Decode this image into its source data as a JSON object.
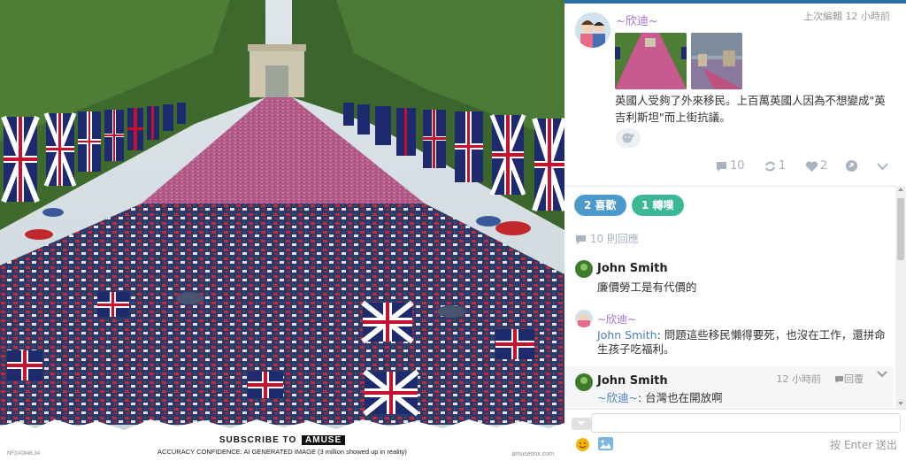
{
  "photo": {
    "subscribe_prefix": "SUBSCRIBE TO",
    "subscribe_brand": "AMUSE",
    "accuracy_text": "ACCURACY CONFIDENCE: AI GENERATED IMAGE (3 million showed up in reality)",
    "image_id": "NF3A0846.34",
    "site": "amuseonx.com"
  },
  "post": {
    "author": "~欣迪~",
    "last_edit": "上次編輯  12 小時前",
    "text": "英國人受夠了外來移民。上百萬英國人因為不想變成\"英吉利斯坦\"而上街抗議。",
    "stats": {
      "replies": "10",
      "reblogs": "1",
      "likes": "2"
    },
    "likes_pill": "2 喜歡",
    "reblogs_pill": "1 轉噗",
    "reply_count": "10 則回應"
  },
  "comments": [
    {
      "name": "John Smith",
      "text": "廉價勞工是有代價的"
    },
    {
      "name": "~欣迪~",
      "mention": "John Smith",
      "text": ": 問題這些移民懶得要死，也沒在工作，還拼命生孩子吃福利。"
    },
    {
      "name": "John Smith",
      "mention": "~欣迪~",
      "text": ": 台灣也在開放啊",
      "time": "12 小時前",
      "reply_label": "回覆"
    }
  ],
  "input": {
    "enter_hint": "按 Enter 送出"
  },
  "colors": {
    "accent_blue": "#4c9acb",
    "accent_green": "#3ab795",
    "author_purple": "#a472d1",
    "stat_gray": "#a7b4c2"
  },
  "icons": [
    "reply-icon",
    "reblog-icon",
    "heart-icon",
    "share-icon",
    "chevron-down-icon",
    "emoji-icon",
    "image-icon"
  ]
}
